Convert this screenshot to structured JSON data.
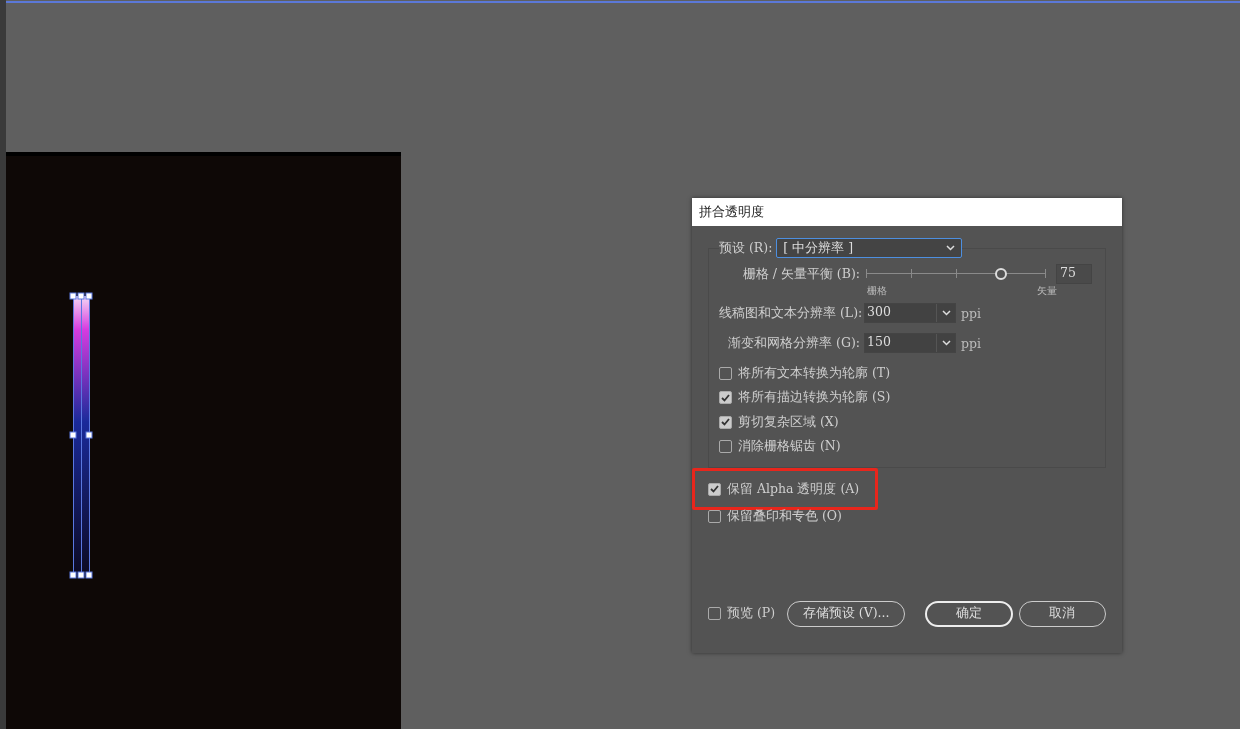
{
  "dialog": {
    "title": "拼合透明度",
    "preset": {
      "label": "预设 (R):",
      "value": "[ 中分辨率 ]"
    },
    "balance": {
      "label": "栅格 / 矢量平衡 (B):",
      "level": 0.75,
      "value": "75",
      "min_label": "栅格",
      "max_label": "矢量"
    },
    "resolutions": [
      {
        "label": "线稿图和文本分辨率 (L):",
        "value": "300",
        "unit": "ppi"
      },
      {
        "label": "渐变和网格分辨率 (G):",
        "value": "150",
        "unit": "ppi"
      }
    ],
    "group_options": [
      {
        "label": "将所有文本转换为轮廓 (T)",
        "checked": false
      },
      {
        "label": "将所有描边转换为轮廓 (S)",
        "checked": true
      },
      {
        "label": "剪切复杂区域 (X)",
        "checked": true
      },
      {
        "label": "消除栅格锯齿 (N)",
        "checked": false
      }
    ],
    "options": [
      {
        "label": "保留 Alpha 透明度 (A)",
        "checked": true,
        "highlighted": true
      },
      {
        "label": "保留叠印和专色 (O)",
        "checked": false,
        "highlighted": false
      }
    ],
    "preview": {
      "label": "预览 (P)",
      "checked": false
    },
    "buttons": [
      {
        "label": "存储预设 (V)...",
        "kind": "secondary"
      },
      {
        "label": "确定",
        "kind": "primary"
      },
      {
        "label": "取消",
        "kind": "secondary"
      }
    ]
  }
}
